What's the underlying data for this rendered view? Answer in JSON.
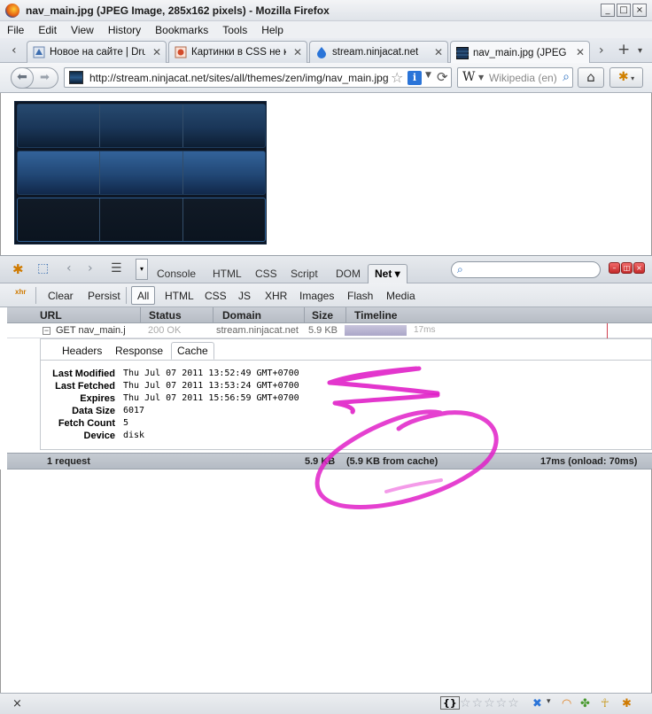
{
  "window": {
    "title": "nav_main.jpg (JPEG Image, 285x162 pixels) - Mozilla Firefox",
    "minimize": "_",
    "maximize": "□",
    "close": "×"
  },
  "menu": [
    "File",
    "Edit",
    "View",
    "History",
    "Bookmarks",
    "Tools",
    "Help"
  ],
  "tabs": [
    {
      "label": "Новое на сайте | Dru...",
      "active": false
    },
    {
      "label": "Картинки в CSS не к...",
      "active": false
    },
    {
      "label": "stream.ninjacat.net",
      "active": false
    },
    {
      "label": "nav_main.jpg (JPEG I...",
      "active": true
    }
  ],
  "navbar": {
    "url": "http://stream.ninjacat.net/sites/all/themes/zen/img/nav_main.jpg",
    "search_placeholder": "Wikipedia (en)",
    "search_engine_letter": "W",
    "identity_letter": "i"
  },
  "image": {
    "width": 285,
    "height": 162,
    "rows": 3,
    "cols": 3
  },
  "firebug": {
    "panels": [
      "Console",
      "HTML",
      "CSS",
      "Script",
      "DOM"
    ],
    "active_panel": "Net ▾",
    "sub_actions": [
      "Clear",
      "Persist"
    ],
    "filters": [
      "All",
      "HTML",
      "CSS",
      "JS",
      "XHR",
      "Images",
      "Flash",
      "Media"
    ],
    "active_filter": "All",
    "xhr_label": "xhr",
    "columns": [
      "URL",
      "Status",
      "Domain",
      "Size",
      "Timeline"
    ],
    "request": {
      "expander": "−",
      "url": "GET nav_main.j",
      "status": "200 OK",
      "domain": "stream.ninjacat.net",
      "size": "5.9 KB",
      "time": "17ms"
    },
    "detail_tabs": [
      "Headers",
      "Response",
      "Cache"
    ],
    "active_detail_tab": "Cache",
    "cache": [
      {
        "key": "Last Modified",
        "value": "Thu Jul 07 2011 13:52:49 GMT+0700"
      },
      {
        "key": "Last Fetched",
        "value": "Thu Jul 07 2011 13:53:24 GMT+0700"
      },
      {
        "key": "Expires",
        "value": "Thu Jul 07 2011 15:56:59 GMT+0700"
      },
      {
        "key": "Data Size",
        "value": "6017"
      },
      {
        "key": "Fetch Count",
        "value": "5"
      },
      {
        "key": "Device",
        "value": "disk"
      }
    ],
    "summary": {
      "requests": "1 request",
      "size": "5.9 KB",
      "cache": "(5.9 KB from cache)",
      "timing": "17ms (onload: 70ms)"
    }
  },
  "statusbar": {
    "close": "×",
    "braces": "{}",
    "stars": "☆☆☆☆☆"
  },
  "colors": {
    "annotation": "#e020c8",
    "nav_image_dark": "#0d1624",
    "accent_blue": "#2a74d8"
  }
}
